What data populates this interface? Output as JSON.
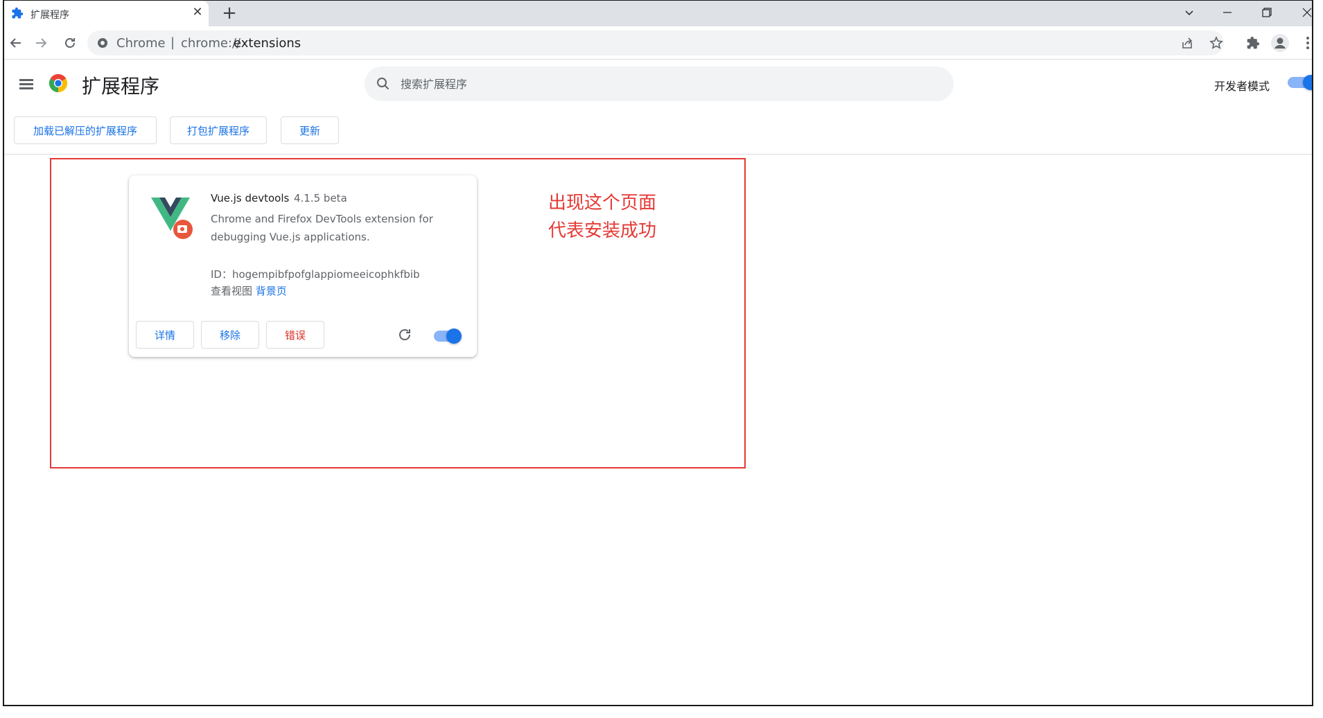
{
  "tab": {
    "title": "扩展程序",
    "close_glyph": "✕"
  },
  "newtab_glyph": "+",
  "window_controls": {
    "minimize": "—",
    "restore": "❐",
    "close": "✕",
    "dropdown": "⌄"
  },
  "omnibox": {
    "origin": "Chrome",
    "separator": "|",
    "scheme": "chrome://",
    "host": "extensions"
  },
  "header": {
    "title": "扩展程序",
    "search_placeholder": "搜索扩展程序",
    "devmode_label": "开发者模式",
    "devmode_on": true
  },
  "actions": {
    "load_unpacked": "加载已解压的扩展程序",
    "pack": "打包扩展程序",
    "update": "更新"
  },
  "extension": {
    "name": "Vue.js devtools",
    "version": "4.1.5 beta",
    "description": "Chrome and Firefox DevTools extension for debugging Vue.js applications.",
    "id_text": "ID：hogempibfpofglappiomeeicophkfbib",
    "views_label": "查看视图",
    "views_link": "背景页",
    "details_label": "详情",
    "remove_label": "移除",
    "errors_label": "错误",
    "enabled": true
  },
  "annotation": {
    "line1": "出现这个页面",
    "line2": "代表安装成功"
  },
  "colors": {
    "accent": "#1a73e8",
    "error": "#d93025",
    "annotation": "#e53935",
    "vue_green": "#41b883",
    "vue_dark": "#35495e"
  }
}
